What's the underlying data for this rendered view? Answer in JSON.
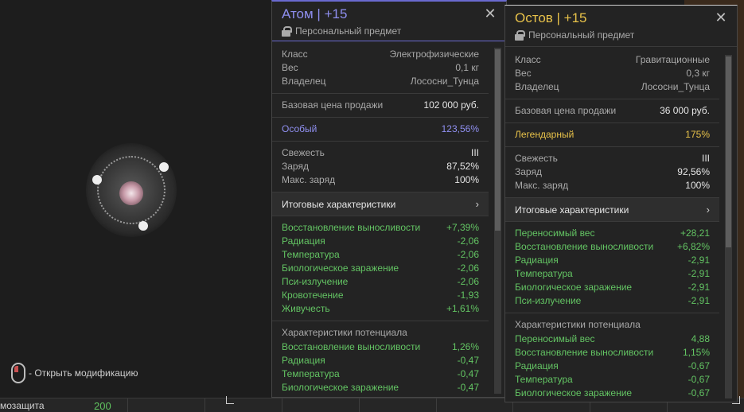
{
  "bottom_bar": {
    "label": "мозащита",
    "value": "200"
  },
  "hint": {
    "text": "- Открыть модификацию"
  },
  "panel1": {
    "title": "Атом | +15",
    "title_color": "#8f8ff0",
    "subtitle": "Персональный предмет",
    "info": [
      {
        "k": "Класс",
        "v": "Электрофизические"
      },
      {
        "k": "Вес",
        "v": "0,1 кг"
      },
      {
        "k": "Владелец",
        "v": "Лососни_Тунца"
      }
    ],
    "price": {
      "k": "Базовая цена продажи",
      "v": "102 000 руб."
    },
    "rarity": {
      "k": "Особый",
      "v": "123,56%",
      "color": "#8f8ff0"
    },
    "state": [
      {
        "k": "Свежесть",
        "v": "III"
      },
      {
        "k": "Заряд",
        "v": "87,52%"
      },
      {
        "k": "Макс. заряд",
        "v": "100%"
      }
    ],
    "summary_label": "Итоговые характеристики",
    "summary_chevron": "›",
    "stats": [
      {
        "k": "Восстановление выносливости",
        "v": "+7,39%"
      },
      {
        "k": "Радиация",
        "v": "-2,06"
      },
      {
        "k": "Температура",
        "v": "-2,06"
      },
      {
        "k": "Биологическое заражение",
        "v": "-2,06"
      },
      {
        "k": "Пси-излучение",
        "v": "-2,06"
      },
      {
        "k": "Кровотечение",
        "v": "-1,93"
      },
      {
        "k": "Живучесть",
        "v": "+1,61%"
      }
    ],
    "potential_title": "Характеристики потенциала",
    "potential": [
      {
        "k": "Восстановление выносливости",
        "v": "1,26%"
      },
      {
        "k": "Радиация",
        "v": "-0,47"
      },
      {
        "k": "Температура",
        "v": "-0,47"
      },
      {
        "k": "Биологическое заражение",
        "v": "-0,47"
      }
    ]
  },
  "panel2": {
    "title": "Остов | +15",
    "title_color": "#e8c24a",
    "subtitle": "Персональный предмет",
    "info": [
      {
        "k": "Класс",
        "v": "Гравитационные"
      },
      {
        "k": "Вес",
        "v": "0,3 кг"
      },
      {
        "k": "Владелец",
        "v": "Лососни_Тунца"
      }
    ],
    "price": {
      "k": "Базовая цена продажи",
      "v": "36 000 руб."
    },
    "rarity": {
      "k": "Легендарный",
      "v": "175%",
      "color": "#e8c24a"
    },
    "state": [
      {
        "k": "Свежесть",
        "v": "III"
      },
      {
        "k": "Заряд",
        "v": "92,56%"
      },
      {
        "k": "Макс. заряд",
        "v": "100%"
      }
    ],
    "summary_label": "Итоговые характеристики",
    "summary_chevron": "›",
    "stats": [
      {
        "k": "Переносимый вес",
        "v": "+28,21"
      },
      {
        "k": "Восстановление выносливости",
        "v": "+6,82%"
      },
      {
        "k": "Радиация",
        "v": "-2,91"
      },
      {
        "k": "Температура",
        "v": "-2,91"
      },
      {
        "k": "Биологическое заражение",
        "v": "-2,91"
      },
      {
        "k": "Пси-излучение",
        "v": "-2,91"
      }
    ],
    "potential_title": "Характеристики потенциала",
    "potential": [
      {
        "k": "Переносимый вес",
        "v": "4,88"
      },
      {
        "k": "Восстановление выносливости",
        "v": "1,15%"
      },
      {
        "k": "Радиация",
        "v": "-0,67"
      },
      {
        "k": "Температура",
        "v": "-0,67"
      },
      {
        "k": "Биологическое заражение",
        "v": "-0,67"
      }
    ]
  }
}
